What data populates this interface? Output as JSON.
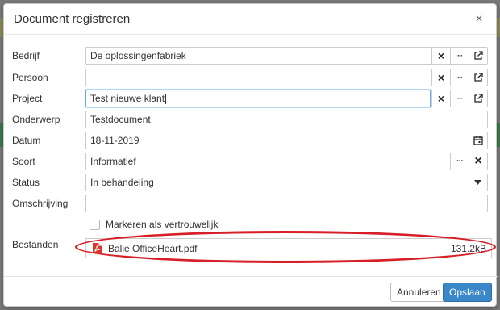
{
  "dialog": {
    "title": "Document registreren",
    "close_glyph": "×"
  },
  "fields": {
    "bedrijf": {
      "label": "Bedrijf",
      "value": "De oplossingenfabriek"
    },
    "persoon": {
      "label": "Persoon",
      "value": ""
    },
    "project": {
      "label": "Project",
      "value": "Test nieuwe klant"
    },
    "onderwerp": {
      "label": "Onderwerp",
      "value": "Testdocument"
    },
    "datum": {
      "label": "Datum",
      "value": "18-11-2019"
    },
    "soort": {
      "label": "Soort",
      "value": "Informatief"
    },
    "status": {
      "label": "Status",
      "value": "In behandeling"
    },
    "omschrijving": {
      "label": "Omschrijving",
      "value": ""
    },
    "vertrouwelijk": {
      "label": "Markeren als vertrouwelijk",
      "checked": false
    },
    "bestanden": {
      "label": "Bestanden",
      "files": [
        {
          "name": "Balie OfficeHeart.pdf",
          "size": "131.2kB",
          "icon": "pdf-file-icon"
        }
      ]
    }
  },
  "addon_glyphs": {
    "clear": "×",
    "more": "···"
  },
  "footer": {
    "cancel_label": "Annuleren",
    "save_label": "Opslaan"
  },
  "colors": {
    "primary": "#3a87c9",
    "highlight": "#d61f26",
    "pdf": "#d9372b"
  }
}
